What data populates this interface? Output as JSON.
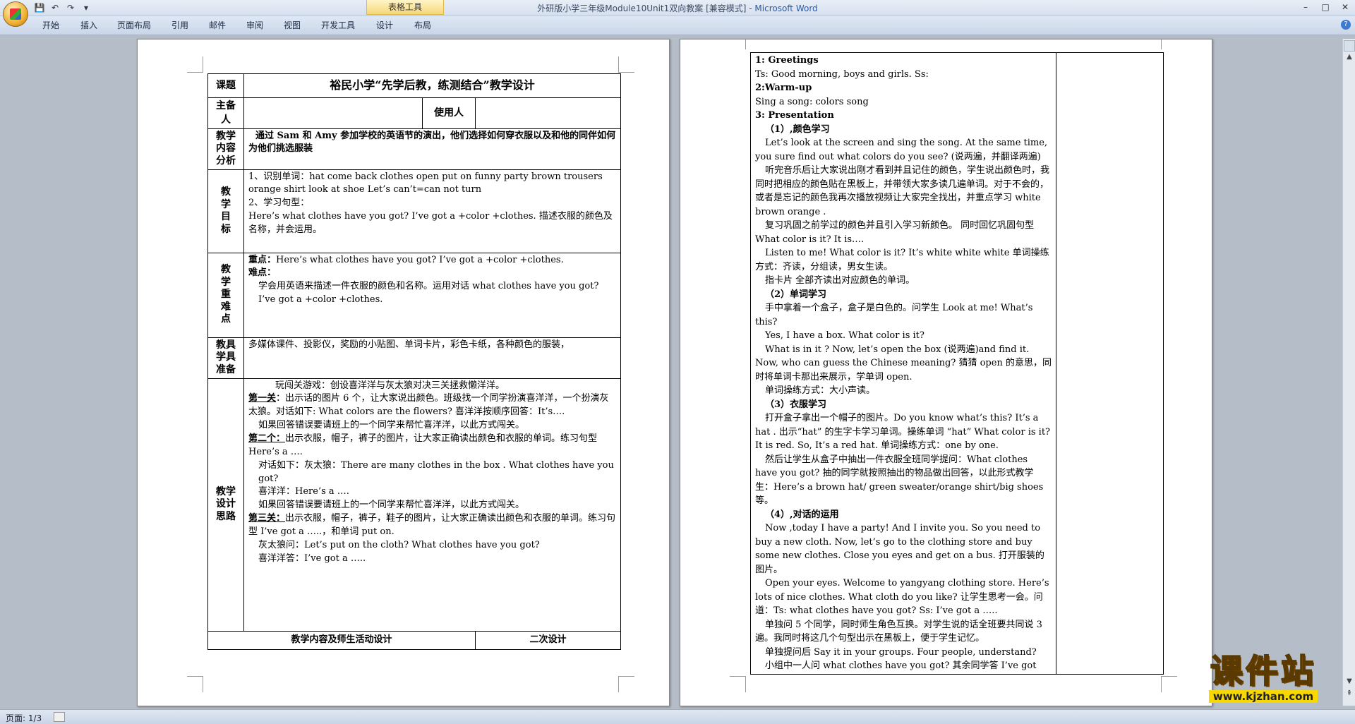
{
  "window": {
    "title": "外研版小学三年级Module10Unit1双向教案 [兼容模式] - ",
    "app_name": "Microsoft Word",
    "context_tab_group": "表格工具",
    "minimize": "–",
    "maximize": "□",
    "close": "✕"
  },
  "qat": {
    "save": "💾",
    "undo": "↶",
    "redo": "↷",
    "customize": "▾"
  },
  "ribbon": {
    "tabs": [
      "开始",
      "插入",
      "页面布局",
      "引用",
      "邮件",
      "审阅",
      "视图",
      "开发工具",
      "设计",
      "布局"
    ]
  },
  "page1": {
    "title_label": "课题",
    "doc_title": "裕民小学“先学后教，练测结合”教学设计",
    "lead_prep_label": "主备人",
    "user_label": "使用人",
    "content_analysis_label": [
      "教学",
      "内容",
      "分析"
    ],
    "content_analysis_text": "通过 Sam 和 Amy 参加学校的英语节的演出，他们选择如何穿衣服以及和他的同伴如何为他们挑选服装",
    "goals_label": [
      "教",
      "学",
      "目",
      "标"
    ],
    "goals_lines": [
      "1、识别单词：hat   come   back   clothes   open   put on   funny   party   brown   trousers   orange   shirt   look at   shoe   Let’s   can’t=can not   turn",
      "2、学习句型：",
      "Here’s    what clothes have you got?   I’ve got a +color +clothes.   描述衣服的颜色及名称，并会运用。"
    ],
    "key_label": [
      "教",
      "学",
      "重",
      "难",
      "点"
    ],
    "key_point_label": "重点：",
    "key_point_text": "Here’s    what clothes have you got?   I’ve got a +color +clothes.",
    "difficult_label": "难点：",
    "difficult_lines": [
      "学会用英语来描述一件衣服的颜色和名称。运用对话 what clothes have you got?",
      "I’ve got a +color +clothes."
    ],
    "tools_label": [
      "教具",
      "学具",
      "准备"
    ],
    "tools_text": "多媒体课件、投影仪，奖励的小贴图、单词卡片，彩色卡纸，各种颜色的服装，",
    "design_label": [
      "教学",
      "设计",
      "思路"
    ],
    "design_intro": "玩闯关游戏：创设喜洋洋与灰太狼对决三关拯救懒洋洋。",
    "level1_label": "第一关",
    "level1_text": "：出示话的图片 6 个，让大家说出颜色。班级找一个同学扮演喜洋洋，一个扮演灰太狼。对话如下: What colors are the flowers?   喜洋洋按顺序回答：It’s….",
    "level1_note": "如果回答错误要请班上的一个同学来帮忙喜洋洋，以此方式闯关。",
    "level2_label": "第二个：",
    "level2_text": "出示衣服，帽子，裤子的图片，让大家正确读出颜色和衣服的单词。练习句型  Here’s a ….",
    "level2_dialog1": "对话如下：灰太狼：There are many clothes in the box .      What clothes have you got?",
    "level2_dialog2": "喜洋洋：Here’s a ….",
    "level2_note": "如果回答错误要请班上的一个同学来帮忙喜洋洋，以此方式闯关。",
    "level3_label": "第三关：",
    "level3_text": "出示衣服，帽子，裤子，鞋子的图片，让大家正确读出颜色和衣服的单词。练习句型 I’ve got a …..，和单词 put on.",
    "level3_dialog1": "灰太狼问：Let’s put on the cloth?    What clothes have you got?",
    "level3_dialog2": "喜洋洋答：I’ve got a …..",
    "footer_left": "教学内容及师生活动设计",
    "footer_right": "二次设计"
  },
  "page2": {
    "lines": [
      {
        "t": "1: Greetings",
        "s": "h"
      },
      {
        "t": "Ts: Good morning, boys and girls. Ss:",
        "s": ""
      },
      {
        "t": "2:Warm-up",
        "s": "h"
      },
      {
        "t": "Sing a song: colors song",
        "s": ""
      },
      {
        "t": "3: Presentation",
        "s": "h"
      },
      {
        "t": "（1）,颜色学习",
        "s": "sub"
      },
      {
        "t": "Let’s look at the screen and sing the song. At the same time, you sure find out what colors do you see? (说两遍，并翻译两遍)",
        "s": "i"
      },
      {
        "t": "听完音乐后让大家说出刚才看到并且记住的颜色，学生说出颜色时，我同时把相应的颜色贴在黑板上，并带领大家多读几遍单词。对于不会的，或者是忘记的颜色我再次播放视频让大家完全找出，并重点学习 white   brown   orange .",
        "s": "i"
      },
      {
        "t": "复习巩固之前学过的颜色并且引入学习新颜色。  同时回忆巩固句型 What color is it? It is….",
        "s": "i"
      },
      {
        "t": "Listen to me! What color is it? It’s white      white   white 单词操练方式：齐读，分组读，男女生读。",
        "s": "i"
      },
      {
        "t": "指卡片  全部齐读出对应颜色的单词。",
        "s": "i"
      },
      {
        "t": "（2）单词学习",
        "s": "sub"
      },
      {
        "t": "手中拿着一个盒子，盒子是白色的。问学生 Look at me! What’s this?",
        "s": "i"
      },
      {
        "t": "Yes, I have a box. What color is it?",
        "s": "i"
      },
      {
        "t": "What is in it ? Now, let’s open the box (说两遍)and find it. Now, who can guess the Chinese meaning?   猜猜 open  的意思，同时将单词卡那出来展示，学单词 open.",
        "s": "i"
      },
      {
        "t": "单词操练方式：大小声读。",
        "s": "i"
      },
      {
        "t": "（3）衣服学习",
        "s": "sub"
      },
      {
        "t": "打开盒子拿出一个帽子的图片。Do you know what’s this? It’s a hat . 出示“hat”  的生字卡学习单词。操练单词 “hat”   What color is it? It is red.     So, It’s a red hat.  单词操练方式：one by one.",
        "s": "i"
      },
      {
        "t": "然后让学生从盒子中抽出一件衣服全班同学提问：What clothes have you got?   抽的同学就按照抽出的物品做出回答，以此形式教学生：Here’s a brown hat/ green sweater/orange shirt/big shoes 等。",
        "s": "i"
      },
      {
        "t": "（4）,对话的运用",
        "s": "sub"
      },
      {
        "t": "Now ,today I have a party! And I invite you. So you need to buy a new cloth. Now, let’s go to the clothing store and buy some new clothes. Close you eyes and get on a bus.  打开服装的图片。",
        "s": "i"
      },
      {
        "t": "Open your eyes.   Welcome to yangyang clothing store.  Here’s lots of nice clothes. What cloth do you like?  让学生思考一会。问道：Ts: what clothes have you got?    Ss: I’ve got a …..",
        "s": "i"
      },
      {
        "t": "单独问 5 个同学，同时师生角色互换。对学生说的话全班要共同说 3 遍。我同时将这几个句型出示在黑板上，便于学生记忆。",
        "s": "i"
      },
      {
        "t": "单独提问后    Say it in your groups.    Four people, understand?",
        "s": "i"
      },
      {
        "t": "小组中一人问 what clothes have you got?   其余同学答 I’ve got",
        "s": "i"
      }
    ]
  },
  "status": {
    "page_indicator": "页面: 1/3"
  },
  "watermark": {
    "text": "课件站",
    "url": "www.kjzhan.com"
  }
}
